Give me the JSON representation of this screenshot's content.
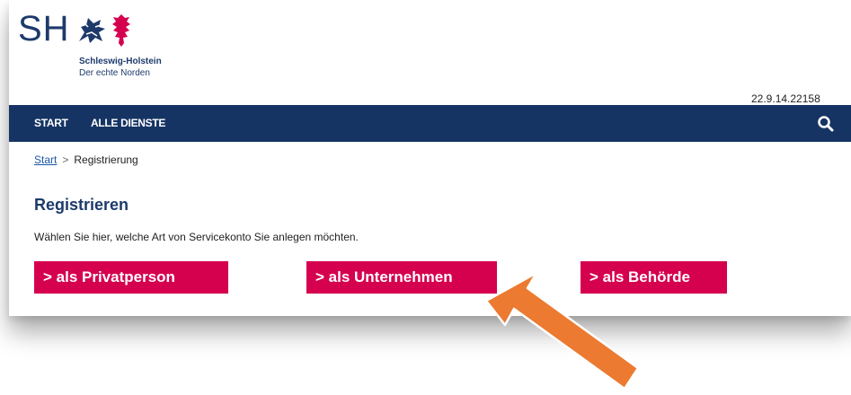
{
  "header": {
    "logo_abbr": "SH",
    "logo_name": "Schleswig-Holstein",
    "logo_tagline": "Der echte Norden",
    "version": "22.9.14.22158"
  },
  "nav": {
    "items": [
      {
        "label": "START"
      },
      {
        "label": "ALLE DIENSTE"
      }
    ],
    "search_icon": "search-icon"
  },
  "breadcrumb": {
    "home": "Start",
    "separator": ">",
    "current": "Registrierung"
  },
  "main": {
    "title": "Registrieren",
    "intro": "Wählen Sie hier, welche Art von Servicekonto Sie anlegen möchten.",
    "buttons": [
      {
        "label": "> als Privatperson"
      },
      {
        "label": "> als Unternehmen"
      },
      {
        "label": "> als Behörde"
      }
    ]
  },
  "colors": {
    "navbar": "#163463",
    "brand_blue": "#1d3a6b",
    "button_red": "#d5004e",
    "annotation_arrow": "#ec7a31"
  }
}
